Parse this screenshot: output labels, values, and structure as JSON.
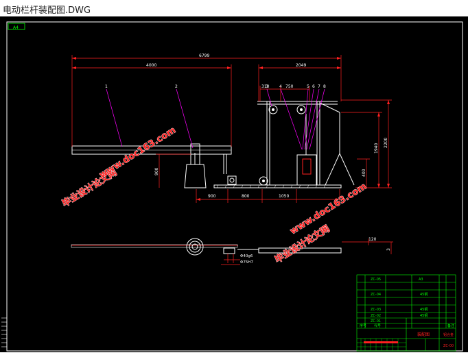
{
  "window": {
    "title": "电动栏杆装配图.DWG"
  },
  "colors": {
    "frame": "#ffffff",
    "dim": "#ff2020",
    "leader": "#ff00ff",
    "table": "#00ff00",
    "watermark": "#ff2020"
  },
  "drawing": {
    "sheet_tag": "A4",
    "dims": {
      "overall": "6799",
      "left": "4000",
      "right": "2049",
      "d310": "310",
      "d750": "750",
      "post_h": "900",
      "d900": "900",
      "d800": "800",
      "d1050": "1050",
      "h1940": "1940",
      "h2200": "2200",
      "h400": "400",
      "d120": "120",
      "d3": "3",
      "phi1": "Φ40g6",
      "phi2": "Φ75H7"
    },
    "balloons": [
      "1",
      "2",
      "3",
      "4",
      "5",
      "6",
      "7",
      "8"
    ],
    "watermarks": [
      "毕业设计论文网",
      "www.doc163.com"
    ]
  },
  "title_block": {
    "rows": [
      [
        "ZC-05",
        "",
        "",
        "A3"
      ],
      [
        "",
        "",
        "",
        ""
      ],
      [
        "ZC-04",
        "",
        "",
        "45钢"
      ],
      [
        "",
        "",
        "",
        ""
      ],
      [
        "ZC-03",
        "",
        "",
        "45钢"
      ],
      [
        "ZC-02",
        "",
        "",
        "45钢"
      ],
      [
        "ZC-01",
        "",
        "",
        ""
      ],
      [
        "序号",
        "代号",
        "",
        "备注"
      ]
    ],
    "title": "装配图",
    "material": "铝合金",
    "number": "ZC-00"
  }
}
